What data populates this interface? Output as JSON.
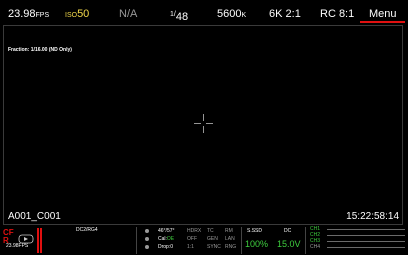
{
  "topbar": {
    "fps_value": "23.98",
    "fps_unit": "FPS",
    "iso_label": "ISO",
    "iso_value": "50",
    "fstop": "N/A",
    "shutter_prefix": "1/",
    "shutter_value": "48",
    "wb_value": "5600",
    "wb_unit": "K",
    "resolution_value": "6K",
    "resolution_ratio": "2:1",
    "compression": "RC 8:1",
    "menu_label": "Menu"
  },
  "viewport": {
    "fraction_text": "Fraction: 1/16.00 (ND Only)",
    "clip_name": "A001_C001",
    "timecode": "15:22:58:14"
  },
  "bottombar": {
    "fps_small": "23.98FPS",
    "codec": "DC2/RG4",
    "tilt": "46°/57°",
    "cal": "Cal:OE",
    "cal_status": "Cal:",
    "cal_value": "OE",
    "drop": "Drop:0",
    "col1": [
      "HDRX",
      "OFF",
      "1:1"
    ],
    "col2": [
      "TC",
      "GEN",
      "SYNC"
    ],
    "col3": [
      "RM",
      "LAN",
      "RNG"
    ],
    "media_label": "S.SSD",
    "media_value": "100%",
    "power_label": "DC",
    "power_value": "15.0V",
    "channels": [
      "CH1",
      "CH2",
      "CH3",
      "CH4"
    ]
  },
  "colors": {
    "accent_red": "#e01010",
    "iso_yellow": "#f2d84a",
    "status_green": "#3ecf3e"
  }
}
